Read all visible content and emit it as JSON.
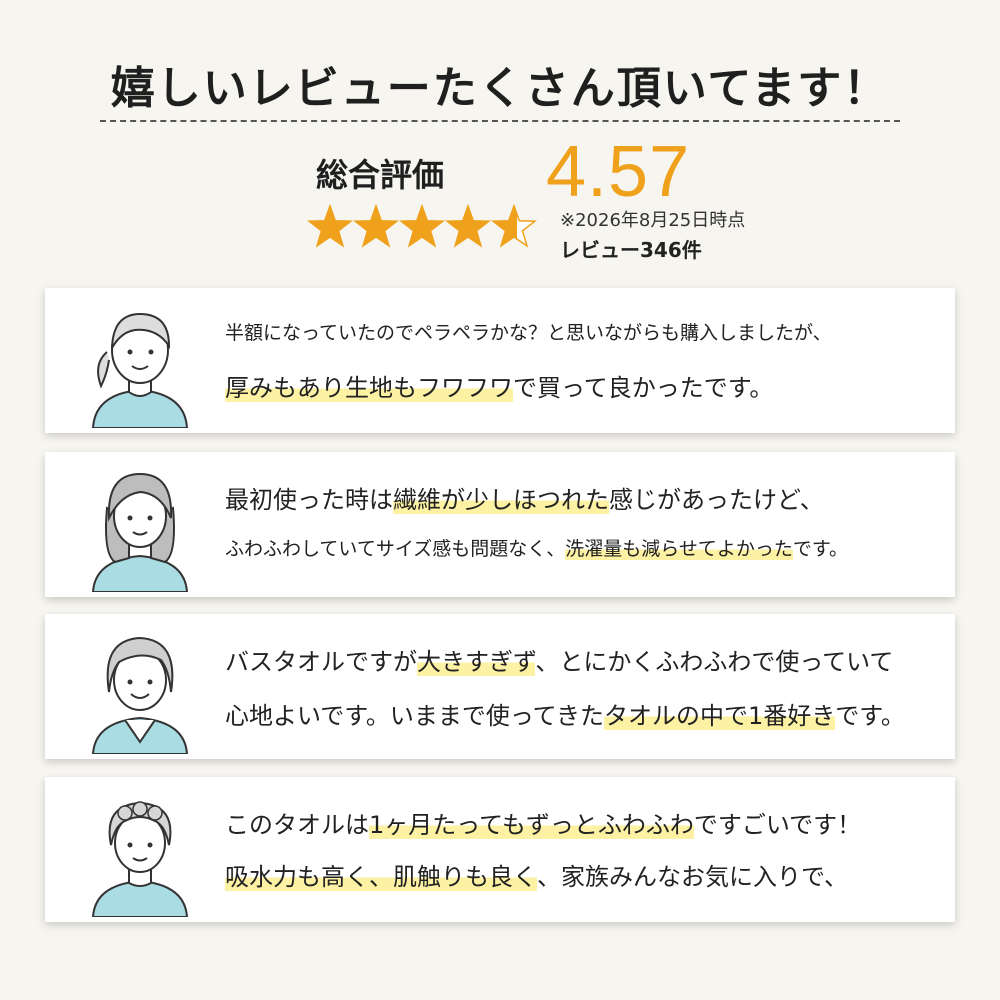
{
  "header": {
    "title": "嬉しいレビューたくさん頂いてます！",
    "rating_label": "総合評価",
    "score": "4.57",
    "rating_value": 4.57,
    "rating_max": 5,
    "as_of": "※2026年8月25日時点",
    "review_count": "レビュー346件"
  },
  "colors": {
    "accent": "#f0a11b",
    "highlight": "#fdf1a3",
    "background": "#f7f5f0",
    "shirt": "#a9dde3"
  },
  "reviews": [
    {
      "avatar": "woman-ponytail-icon",
      "lines": [
        {
          "parts": [
            "半額になっていたのでペラペラかな？と思いながらも購入しましたが、"
          ]
        },
        {
          "parts": [
            "",
            "厚みもあり生地もフワフワ",
            "で買って良かったです。"
          ]
        }
      ]
    },
    {
      "avatar": "woman-long-hair-icon",
      "lines": [
        {
          "parts": [
            "最初使った時は",
            "繊維が少しほつれた",
            "感じがあったけど、"
          ]
        },
        {
          "parts": [
            "ふわふわしていてサイズ感も問題なく、",
            "洗濯量も減らせてよかった",
            "です。"
          ]
        }
      ]
    },
    {
      "avatar": "older-woman-icon",
      "lines": [
        {
          "parts": [
            "バスタオルですが",
            "大きすぎず",
            "、とにかくふわふわで使っていて"
          ]
        },
        {
          "parts": [
            "心地よいです。いままで使ってきた",
            "タオルの中で1番好き",
            "です。"
          ]
        }
      ]
    },
    {
      "avatar": "elderly-woman-icon",
      "lines": [
        {
          "parts": [
            "このタオルは",
            "1ヶ月たってもずっとふわふわ",
            "ですごいです！"
          ]
        },
        {
          "parts": [
            "",
            "吸水力も高く、肌触りも良く",
            "、家族みんなお気に入りで、"
          ]
        }
      ]
    }
  ]
}
